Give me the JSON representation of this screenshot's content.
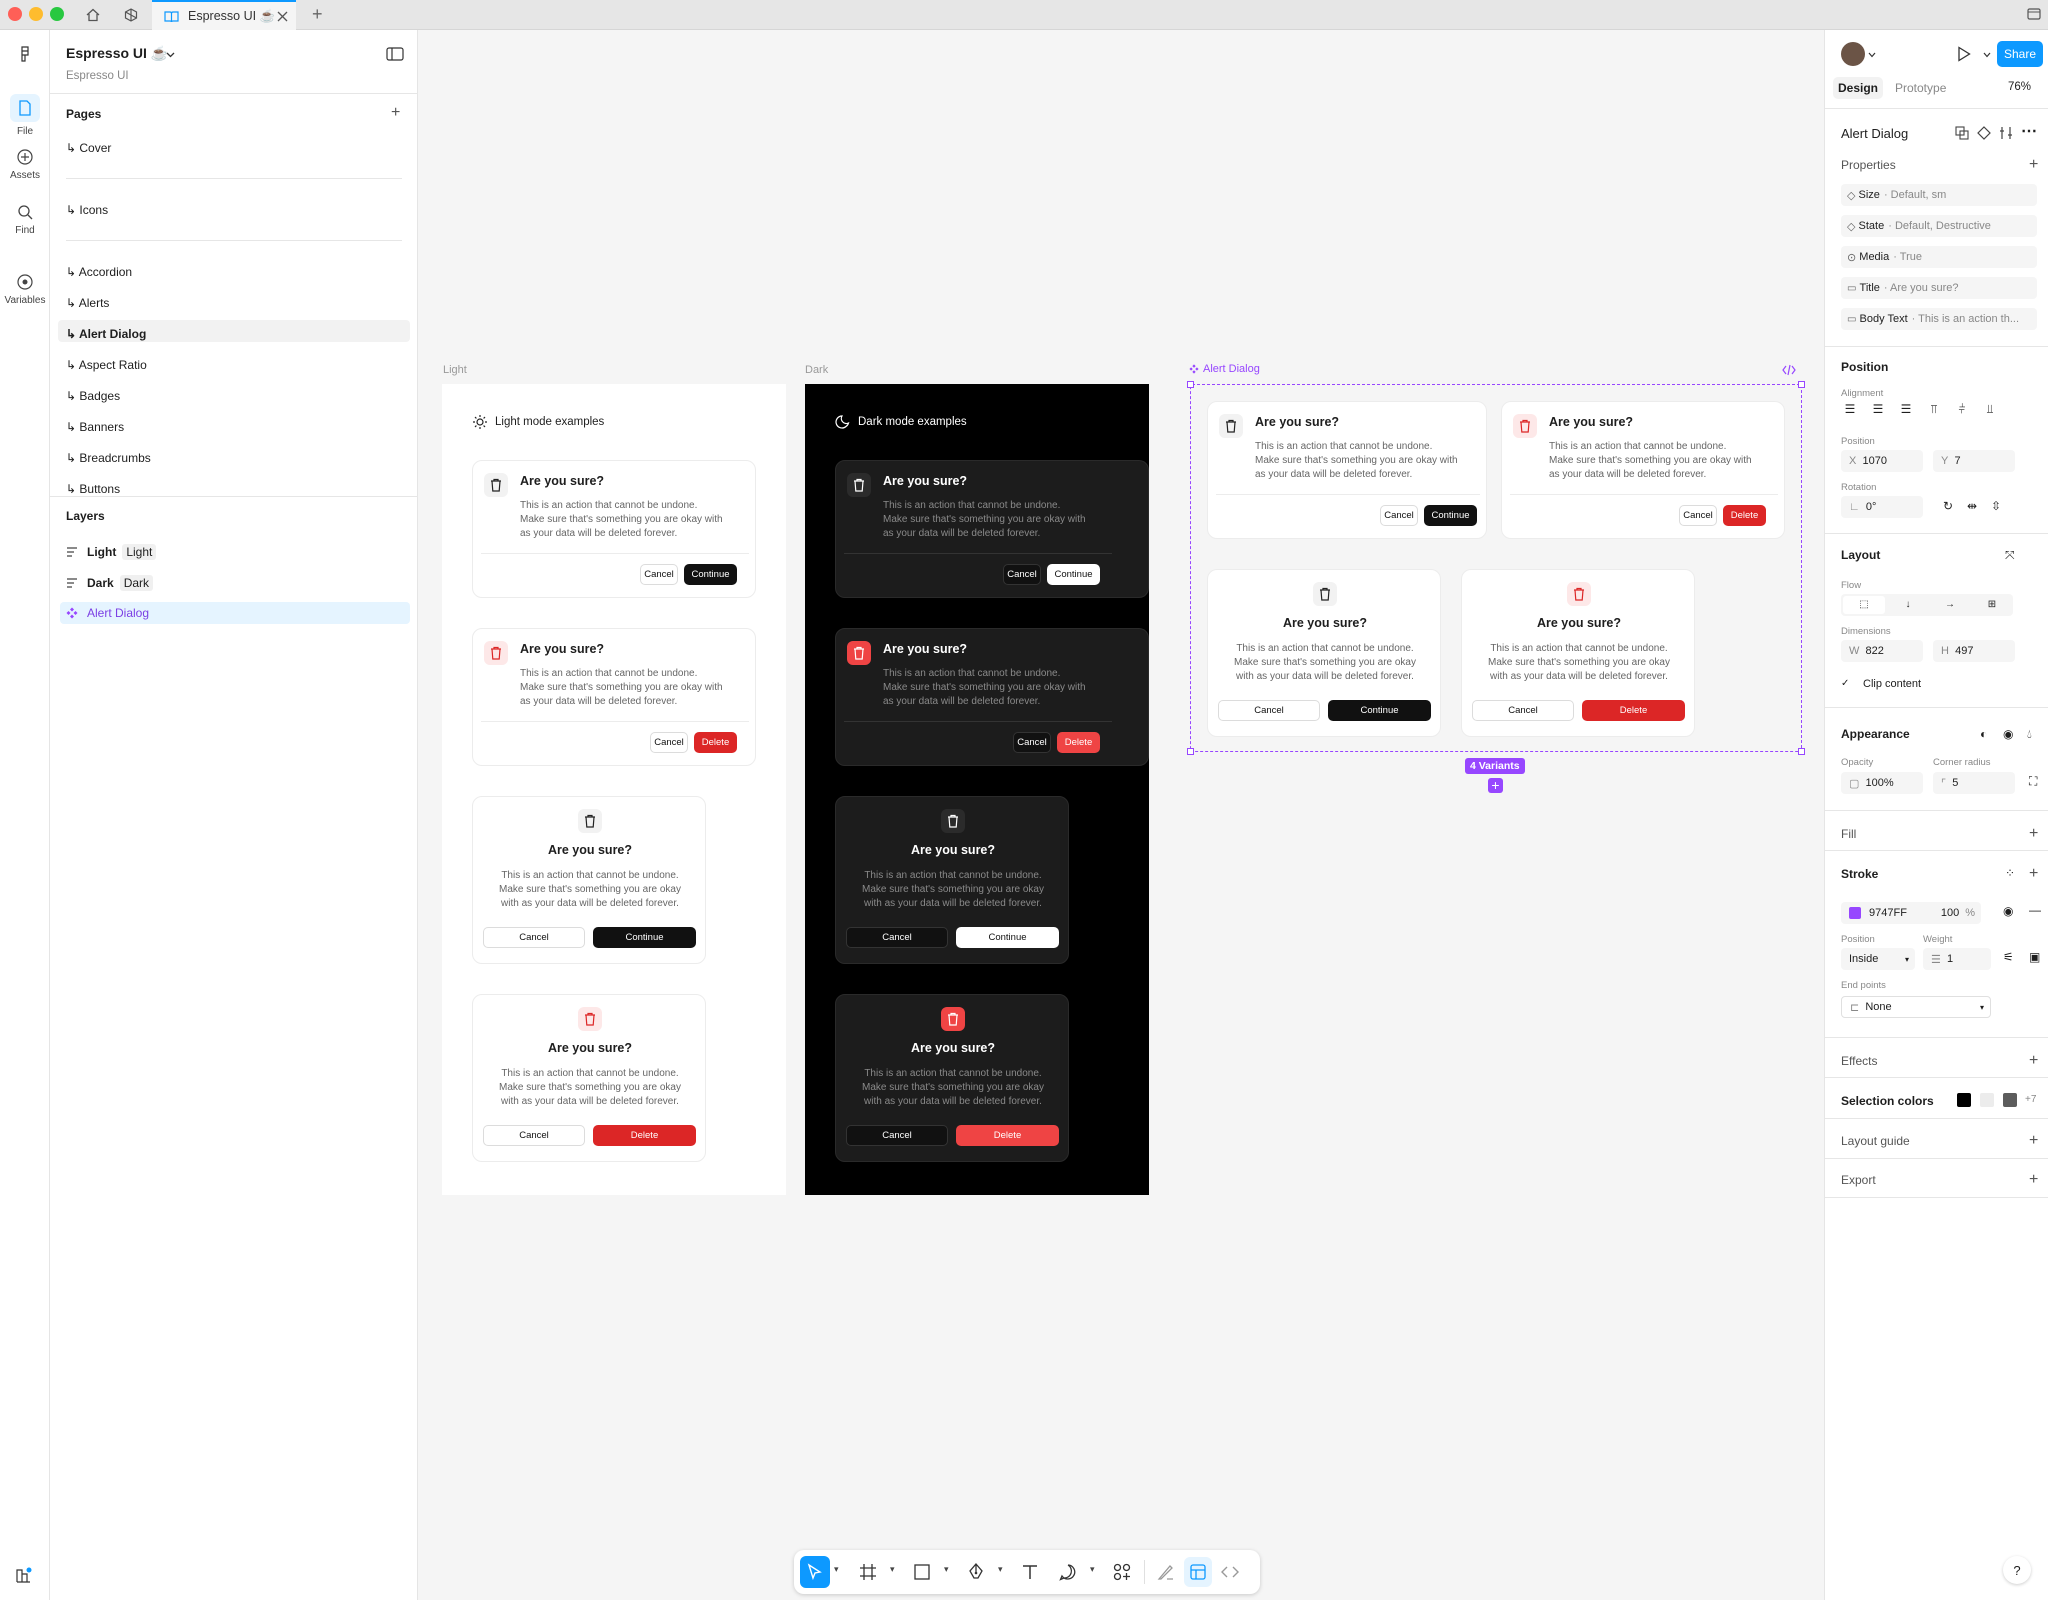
{
  "tabs": {
    "file_tab": "Espresso UI ☕",
    "new_tab": "+"
  },
  "file": {
    "name": "Espresso UI ☕",
    "subtitle": "Espresso UI"
  },
  "rail": {
    "file": "File",
    "assets": "Assets",
    "find": "Find",
    "variables": "Variables"
  },
  "pages": {
    "title": "Pages",
    "items": [
      "↳ Cover",
      "↳ Icons",
      "↳ Accordion",
      "↳ Alerts",
      "↳ Alert Dialog",
      "↳ Aspect Ratio",
      "↳ Badges",
      "↳ Banners",
      "↳ Breadcrumbs",
      "↳ Buttons"
    ]
  },
  "layers": {
    "title": "Layers",
    "light": "Light",
    "light_tag": "Light",
    "dark": "Dark",
    "dark_tag": "Dark",
    "alert": "Alert Dialog"
  },
  "canvas": {
    "light_label": "Light",
    "dark_label": "Dark",
    "alert_label": "Alert Dialog",
    "light_header": "Light mode examples",
    "dark_header": "Dark mode examples",
    "dialog_title": "Are you sure?",
    "body_1": "This is an action that cannot be undone.",
    "body_2": "Make sure that's something you are okay with",
    "body_3": "as your data will be deleted forever.",
    "cbody_2": "Make sure that's something you are okay",
    "cbody_3": "with as your data will be deleted forever.",
    "cancel": "Cancel",
    "continue": "Continue",
    "delete": "Delete",
    "variants": "4 Variants"
  },
  "right": {
    "share": "Share",
    "design_tab": "Design",
    "prototype_tab": "Prototype",
    "zoom": "76%",
    "component": "Alert Dialog",
    "properties": "Properties",
    "props": [
      {
        "name": "Size",
        "value": "· Default, sm"
      },
      {
        "name": "State",
        "value": "· Default, Destructive"
      },
      {
        "name": "Media",
        "value": "· True"
      },
      {
        "name": "Title",
        "value": "· Are you sure?"
      },
      {
        "name": "Body Text",
        "value": "· This is an action th..."
      }
    ],
    "position": "Position",
    "alignment": "Alignment",
    "position_sub": "Position",
    "x_label": "X",
    "x": "1070",
    "y_label": "Y",
    "y": "7",
    "rotation": "Rotation",
    "rot": "0°",
    "layout": "Layout",
    "flow": "Flow",
    "dimensions": "Dimensions",
    "w_label": "W",
    "w": "822",
    "h_label": "H",
    "h": "497",
    "clip": "Clip content",
    "appearance": "Appearance",
    "opacity": "Opacity",
    "opacity_v": "100%",
    "corner": "Corner radius",
    "corner_v": "5",
    "fill": "Fill",
    "stroke": "Stroke",
    "stroke_hex": "9747FF",
    "stroke_pct": "100",
    "pct": "%",
    "stroke_pos_label": "Position",
    "weight_label": "Weight",
    "stroke_pos": "Inside",
    "weight": "1",
    "endpoints": "End points",
    "endpoints_v": "None",
    "effects": "Effects",
    "selection_colors": "Selection colors",
    "more_colors": "+7",
    "layout_guide": "Layout guide",
    "export": "Export"
  },
  "help": "?",
  "colors": {
    "accent": "#9747FF",
    "share": "#0d99ff",
    "destructive": "#dc2626"
  }
}
